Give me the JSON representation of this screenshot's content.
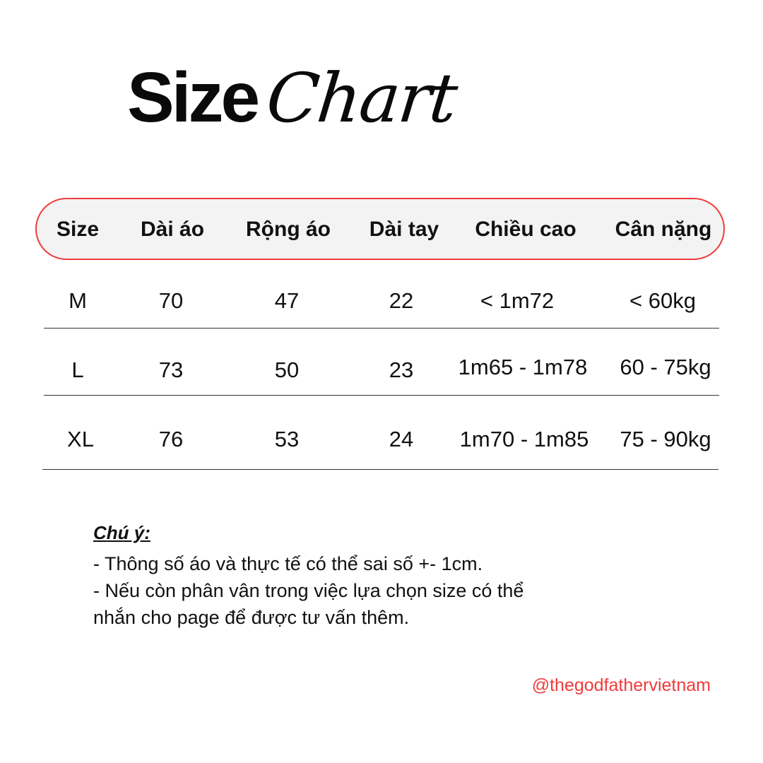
{
  "title": {
    "bold": "Size",
    "script": "Chart"
  },
  "table": {
    "headers": [
      "Size",
      "Dài áo",
      "Rộng áo",
      "Dài tay",
      "Chiều cao",
      "Cân nặng"
    ],
    "rows": [
      [
        "M",
        "70",
        "47",
        "22",
        "< 1m72",
        "< 60kg"
      ],
      [
        "L",
        "73",
        "50",
        "23",
        "1m65 - 1m78",
        "60 - 75kg"
      ],
      [
        "XL",
        "76",
        "53",
        "24",
        "1m70 - 1m85",
        "75 - 90kg"
      ]
    ]
  },
  "note": {
    "title": "Chú ý:",
    "lines": [
      "- Thông số áo và thực tế có thể sai số +- 1cm.",
      "- Nếu còn phân vân trong việc lựa chọn size có thể",
      "nhắn cho page để được tư vấn thêm."
    ]
  },
  "handle": "@thegodfathervietnam",
  "colors": {
    "accent": "#ef3b3b",
    "text": "#111111",
    "header_bg": "#f3f3f3",
    "background": "#ffffff"
  }
}
